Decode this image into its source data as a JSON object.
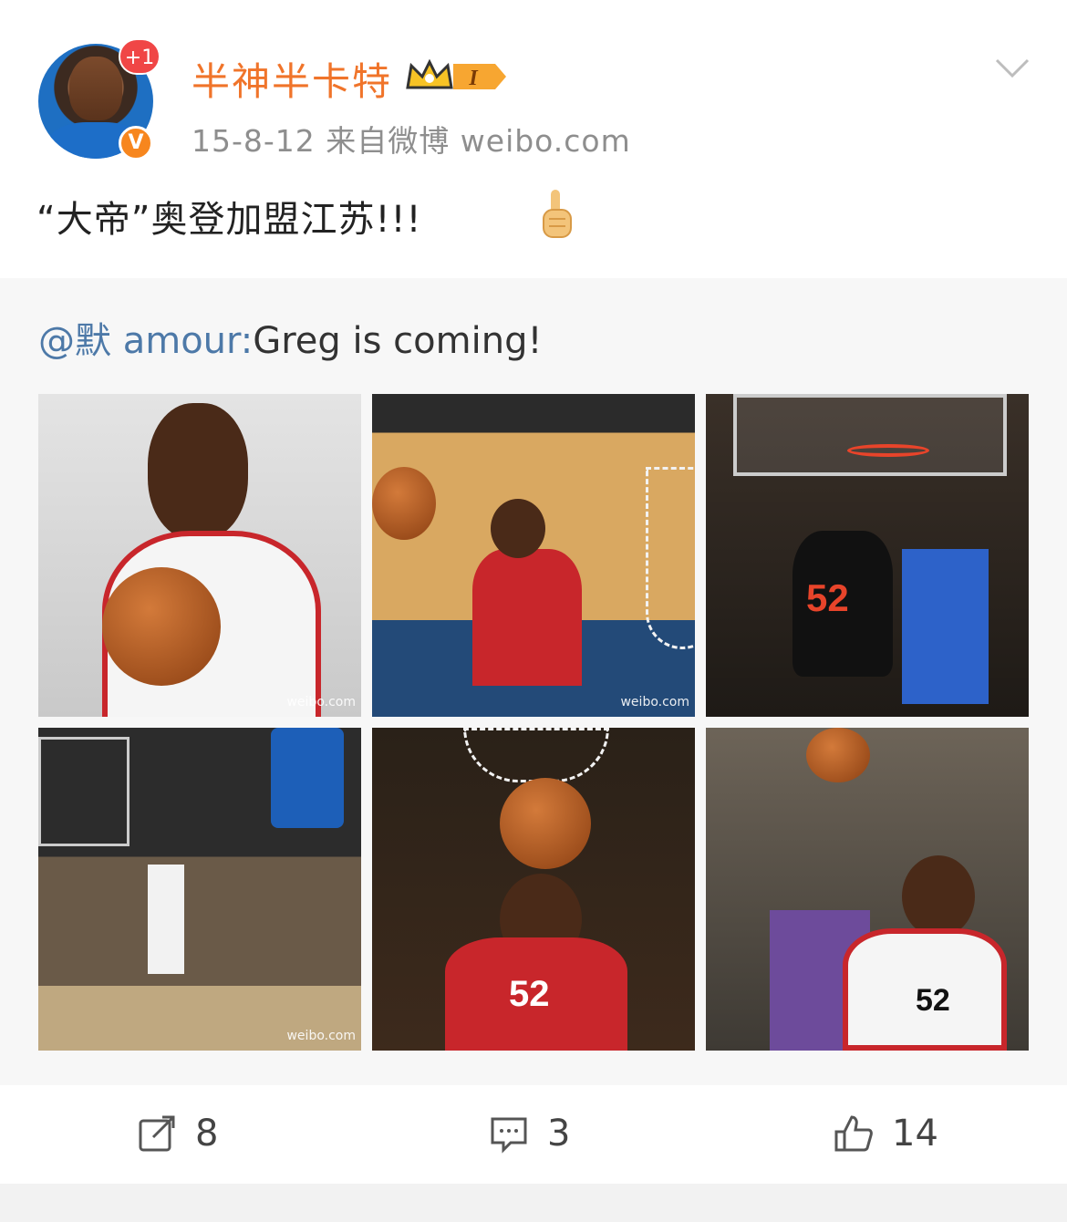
{
  "header": {
    "username": "半神半卡特",
    "notification_badge": "+1",
    "verified_badge": "V",
    "member_level": "I",
    "meta": "15-8-12  来自微博 weibo.com",
    "icons": {
      "avatar": "avatar-image",
      "member": "crown-icon",
      "menu": "chevron-down-icon"
    }
  },
  "post": {
    "text": "“大帝”奥登加盟江苏!!!",
    "emoji": "thumbs-up-icon"
  },
  "repost": {
    "mention": "@默 amour:",
    "text": "Greg is coming!",
    "photos": [
      {
        "name": "photo-1",
        "watermark": "weibo.com"
      },
      {
        "name": "photo-2",
        "watermark": "weibo.com"
      },
      {
        "name": "photo-3",
        "jersey": "52"
      },
      {
        "name": "photo-4",
        "watermark": "weibo.com"
      },
      {
        "name": "photo-5",
        "jersey": "52"
      },
      {
        "name": "photo-6",
        "jersey": "52"
      }
    ]
  },
  "actions": {
    "repost_count": "8",
    "comment_count": "3",
    "like_count": "14"
  },
  "colors": {
    "username": "#f0742a",
    "mention": "#4d79a8",
    "badge": "#f04646",
    "verified": "#f7861e"
  }
}
